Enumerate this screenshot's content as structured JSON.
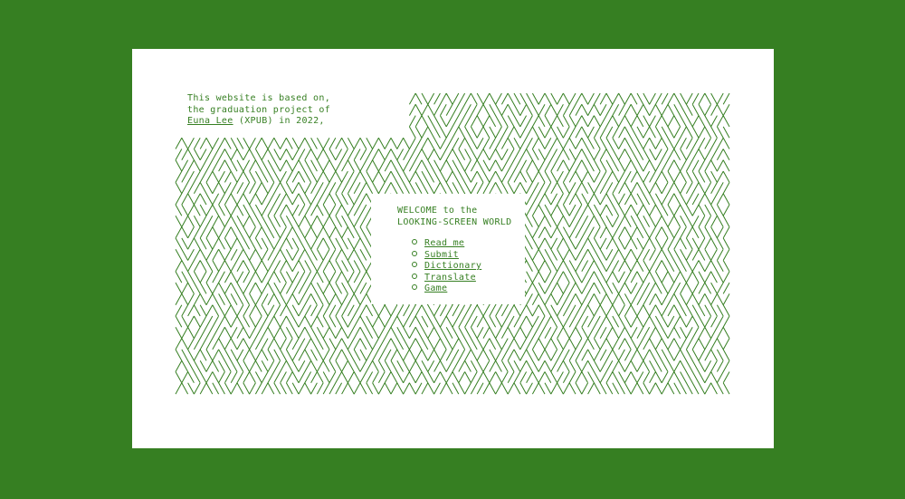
{
  "colors": {
    "accent": "#367f22",
    "background": "#ffffff"
  },
  "intro": {
    "line1": "This website is based on,",
    "line2": "the graduation project of",
    "author_link": "Euna Lee",
    "affiliation": "(XPUB)",
    "year_text": "in 2022,"
  },
  "welcome": {
    "line1": "WELCOME to the",
    "line2": "LOOKING-SCREEN WORLD"
  },
  "menu": [
    {
      "label": "Read me"
    },
    {
      "label": "Submit"
    },
    {
      "label": "Dictionary"
    },
    {
      "label": "Translate"
    },
    {
      "label": "Game"
    }
  ]
}
